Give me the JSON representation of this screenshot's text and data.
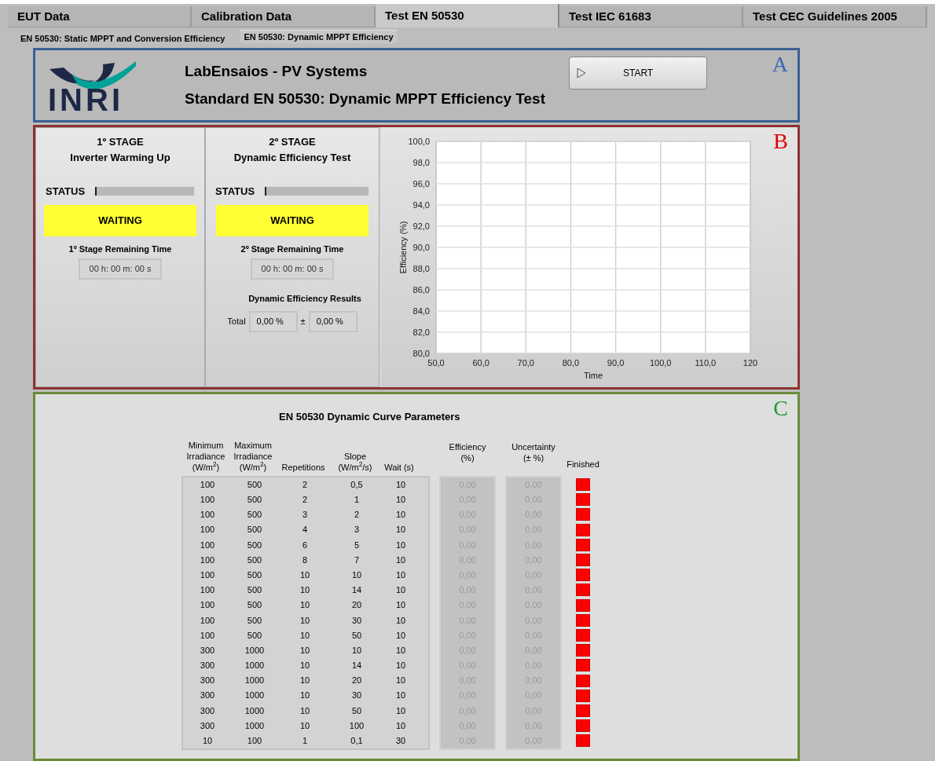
{
  "tabs": [
    {
      "label": "EUT Data",
      "selected": false
    },
    {
      "label": "Calibration Data",
      "selected": false
    },
    {
      "label": "Test EN 50530",
      "selected": true
    },
    {
      "label": "Test IEC 61683",
      "selected": false
    },
    {
      "label": "Test CEC Guidelines 2005",
      "selected": false
    }
  ],
  "subtabs": [
    {
      "label": "EN 50530: Static MPPT and Conversion Efficiency",
      "selected": false
    },
    {
      "label": "EN 50530: Dynamic MPPT Efficiency",
      "selected": true
    }
  ],
  "header": {
    "logo_text": "INRI",
    "title": "LabEnsaios - PV Systems",
    "subtitle": "Standard EN 50530: Dynamic MPPT Efficiency Test",
    "start_button": "START",
    "letter": "A"
  },
  "stages": {
    "letter": "B",
    "items": [
      {
        "title": "1º STAGE",
        "subtitle": "Inverter Warming Up",
        "status_label": "STATUS",
        "level": 0,
        "state": "WAITING",
        "remaining_label": "1º Stage  Remaining Time",
        "remaining": "00 h: 00 m: 00 s"
      },
      {
        "title": "2º STAGE",
        "subtitle": "Dynamic Efficiency Test",
        "status_label": "STATUS",
        "level": 0,
        "state": "WAITING",
        "remaining_label": "2º Stage Remaining Time",
        "remaining": "00 h: 00 m: 00 s",
        "results": {
          "title": "Dynamic Efficiency Results",
          "total_label": "Total",
          "total": "0,00 %",
          "pm": "±",
          "uncertainty": "0,00 %"
        }
      }
    ],
    "chart_data": {
      "type": "line",
      "grid": true,
      "xlabel": "Time",
      "ylabel": "Efficiency (%)",
      "xlim": [
        50,
        120
      ],
      "ylim": [
        80,
        100
      ],
      "xticks": [
        {
          "value": 50,
          "label": "50,0"
        },
        {
          "value": 60,
          "label": "60,0"
        },
        {
          "value": 70,
          "label": "70,0"
        },
        {
          "value": 80,
          "label": "80,0"
        },
        {
          "value": 90,
          "label": "90,0"
        },
        {
          "value": 100,
          "label": "100,0"
        },
        {
          "value": 110,
          "label": "110,0"
        },
        {
          "value": 120,
          "label": "120"
        }
      ],
      "yticks": [
        {
          "value": 80,
          "label": "80,0"
        },
        {
          "value": 82,
          "label": "82,0"
        },
        {
          "value": 84,
          "label": "84,0"
        },
        {
          "value": 86,
          "label": "86,0"
        },
        {
          "value": 88,
          "label": "88,0"
        },
        {
          "value": 90,
          "label": "90,0"
        },
        {
          "value": 92,
          "label": "92,0"
        },
        {
          "value": 94,
          "label": "94,0"
        },
        {
          "value": 96,
          "label": "96,0"
        },
        {
          "value": 98,
          "label": "98,0"
        },
        {
          "value": 100,
          "label": "100,0"
        }
      ]
    }
  },
  "parameters": {
    "letter": "C",
    "title": "EN 50530 Dynamic Curve Parameters",
    "columns": [
      "Minimum Irradiance (W/m$^{2}$)",
      "Maximum Irradiance (W/m$^{2}$)",
      "Repetitions",
      "Slope (W/m$^{2}$/s)",
      "Wait (s)",
      "Efficiency (%)",
      "Uncertainty (± %)",
      "Finished"
    ],
    "rows": [
      {
        "min": "100",
        "max": "500",
        "reps": "2",
        "slope": "0,5",
        "wait": "10",
        "efficiency": "0,00",
        "uncertainty": "0,00",
        "finished": false
      },
      {
        "min": "100",
        "max": "500",
        "reps": "2",
        "slope": "1",
        "wait": "10",
        "efficiency": "0,00",
        "uncertainty": "0,00",
        "finished": false
      },
      {
        "min": "100",
        "max": "500",
        "reps": "3",
        "slope": "2",
        "wait": "10",
        "efficiency": "0,00",
        "uncertainty": "0,00",
        "finished": false
      },
      {
        "min": "100",
        "max": "500",
        "reps": "4",
        "slope": "3",
        "wait": "10",
        "efficiency": "0,00",
        "uncertainty": "0,00",
        "finished": false
      },
      {
        "min": "100",
        "max": "500",
        "reps": "6",
        "slope": "5",
        "wait": "10",
        "efficiency": "0,00",
        "uncertainty": "0,00",
        "finished": false
      },
      {
        "min": "100",
        "max": "500",
        "reps": "8",
        "slope": "7",
        "wait": "10",
        "efficiency": "0,00",
        "uncertainty": "0,00",
        "finished": false
      },
      {
        "min": "100",
        "max": "500",
        "reps": "10",
        "slope": "10",
        "wait": "10",
        "efficiency": "0,00",
        "uncertainty": "0,00",
        "finished": false
      },
      {
        "min": "100",
        "max": "500",
        "reps": "10",
        "slope": "14",
        "wait": "10",
        "efficiency": "0,00",
        "uncertainty": "0,00",
        "finished": false
      },
      {
        "min": "100",
        "max": "500",
        "reps": "10",
        "slope": "20",
        "wait": "10",
        "efficiency": "0,00",
        "uncertainty": "0,00",
        "finished": false
      },
      {
        "min": "100",
        "max": "500",
        "reps": "10",
        "slope": "30",
        "wait": "10",
        "efficiency": "0,00",
        "uncertainty": "0,00",
        "finished": false
      },
      {
        "min": "100",
        "max": "500",
        "reps": "10",
        "slope": "50",
        "wait": "10",
        "efficiency": "0,00",
        "uncertainty": "0,00",
        "finished": false
      },
      {
        "min": "300",
        "max": "1000",
        "reps": "10",
        "slope": "10",
        "wait": "10",
        "efficiency": "0,00",
        "uncertainty": "0,00",
        "finished": false
      },
      {
        "min": "300",
        "max": "1000",
        "reps": "10",
        "slope": "14",
        "wait": "10",
        "efficiency": "0,00",
        "uncertainty": "0,00",
        "finished": false
      },
      {
        "min": "300",
        "max": "1000",
        "reps": "10",
        "slope": "20",
        "wait": "10",
        "efficiency": "0,00",
        "uncertainty": "0,00",
        "finished": false
      },
      {
        "min": "300",
        "max": "1000",
        "reps": "10",
        "slope": "30",
        "wait": "10",
        "efficiency": "0,00",
        "uncertainty": "0,00",
        "finished": false
      },
      {
        "min": "300",
        "max": "1000",
        "reps": "10",
        "slope": "50",
        "wait": "10",
        "efficiency": "0,00",
        "uncertainty": "0,00",
        "finished": false
      },
      {
        "min": "300",
        "max": "1000",
        "reps": "10",
        "slope": "100",
        "wait": "10",
        "efficiency": "0,00",
        "uncertainty": "0,00",
        "finished": false
      },
      {
        "min": "10",
        "max": "100",
        "reps": "1",
        "slope": "0,1",
        "wait": "30",
        "efficiency": "0,00",
        "uncertainty": "0,00",
        "finished": false
      }
    ]
  }
}
